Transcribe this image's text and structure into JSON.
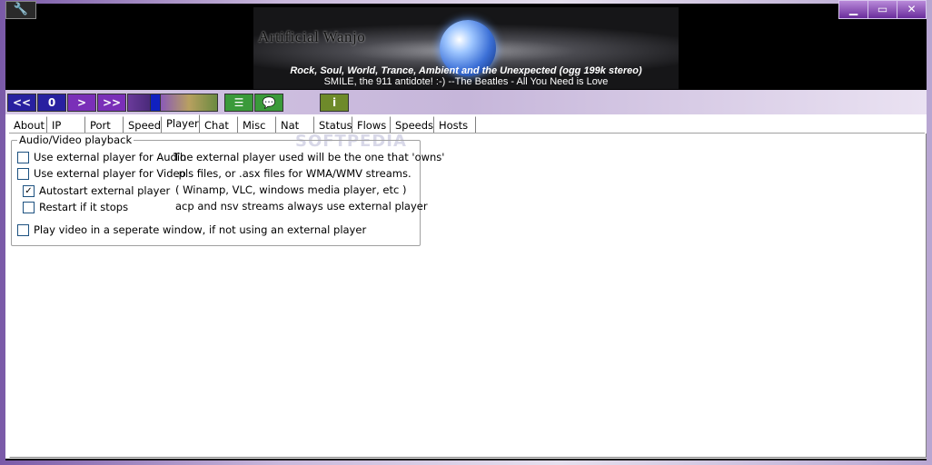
{
  "banner": {
    "title": "Artificial Wanjo",
    "now_playing_line1": "Rock, Soul, World, Trance, Ambient and the  Unexpected  (ogg 199k stereo)",
    "now_playing_line2": "SMILE, the 911 antidote! :-) --The Beatles - All You Need is Love"
  },
  "watermark": "SOFTPEDIA",
  "window_buttons": {
    "tool": "🔧",
    "minimize": "▁",
    "maximize": "▭",
    "close": "✕"
  },
  "toolbar": {
    "prev": "<<",
    "stop": "0",
    "play": ">",
    "next": ">>",
    "info": "i"
  },
  "tabs": [
    "About",
    "IP",
    "Port",
    "Speed",
    "Player",
    "Chat",
    "Misc",
    "Nat",
    "Status",
    "Flows",
    "Speeds",
    "Hosts"
  ],
  "active_tab": "Player",
  "group": {
    "title": "Audio/Video playback",
    "options": [
      {
        "label": "Use external player for Audio",
        "checked": false
      },
      {
        "label": "Use external player for Video",
        "checked": false
      },
      {
        "label": "Autostart external player",
        "checked": true
      },
      {
        "label": "Restart if it stops",
        "checked": false
      },
      {
        "label": "Play video in a seperate window, if not using an external player",
        "checked": false
      }
    ],
    "help": [
      "The external player used will be the one that 'owns'",
      ".pls files, or .asx files for WMA/WMV streams.",
      "( Winamp, VLC, windows media player, etc )",
      "acp and nsv streams always use external player"
    ]
  },
  "colors": {
    "toolbar_blue": "#2820a0",
    "toolbar_purple": "#7a2fb8",
    "toolbar_green": "#3a9a3a"
  }
}
